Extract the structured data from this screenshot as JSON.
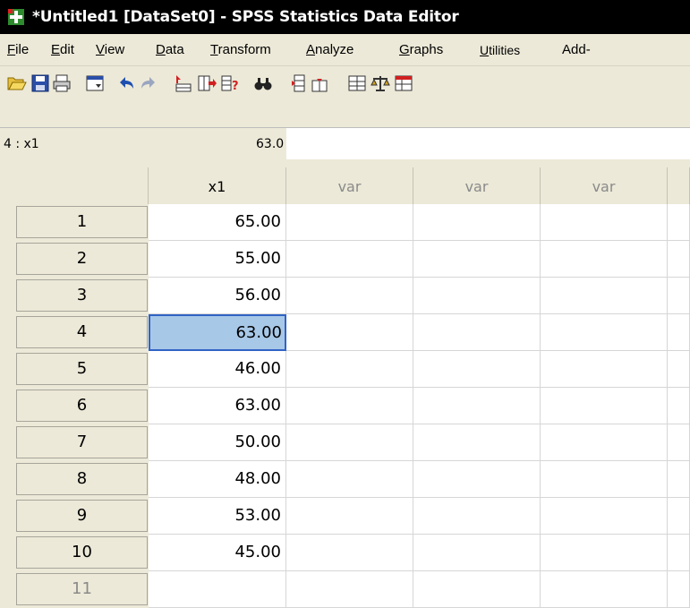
{
  "window": {
    "title": "*Untitled1 [DataSet0] - SPSS Statistics Data Editor"
  },
  "menu": [
    {
      "pre": "",
      "u": "F",
      "post": "ile"
    },
    {
      "pre": "",
      "u": "E",
      "post": "dit"
    },
    {
      "pre": "",
      "u": "V",
      "post": "iew"
    },
    {
      "pre": "",
      "u": "D",
      "post": "ata"
    },
    {
      "pre": "",
      "u": "T",
      "post": "ransform"
    },
    {
      "pre": "",
      "u": "A",
      "post": "nalyze"
    },
    {
      "pre": "",
      "u": "G",
      "post": "raphs"
    },
    {
      "pre": "",
      "u": "U",
      "post": "tilities"
    },
    {
      "pre": "Add-",
      "u": "",
      "post": ""
    }
  ],
  "toolbar_icons": [
    "open-folder-icon",
    "save-icon",
    "print-icon",
    "dialog-recall-icon",
    "undo-icon",
    "redo-icon",
    "goto-case-icon",
    "goto-variable-icon",
    "variables-info-icon",
    "find-icon",
    "insert-cases-icon",
    "insert-variable-icon",
    "split-file-icon",
    "weight-cases-icon",
    "select-cases-icon"
  ],
  "editor": {
    "cell_ref": "4 : x1",
    "cell_value": "63.0"
  },
  "grid": {
    "columns": [
      "x1",
      "var",
      "var",
      "var"
    ],
    "rows": [
      {
        "num": "1",
        "x1": "65.00"
      },
      {
        "num": "2",
        "x1": "55.00"
      },
      {
        "num": "3",
        "x1": "56.00"
      },
      {
        "num": "4",
        "x1": "63.00"
      },
      {
        "num": "5",
        "x1": "46.00"
      },
      {
        "num": "6",
        "x1": "63.00"
      },
      {
        "num": "7",
        "x1": "50.00"
      },
      {
        "num": "8",
        "x1": "48.00"
      },
      {
        "num": "9",
        "x1": "53.00"
      },
      {
        "num": "10",
        "x1": "45.00"
      },
      {
        "num": "11",
        "x1": ""
      }
    ],
    "selected_row": "4"
  },
  "colors": {
    "selection_fill": "#a8c8e8",
    "selection_border": "#3163c5"
  }
}
